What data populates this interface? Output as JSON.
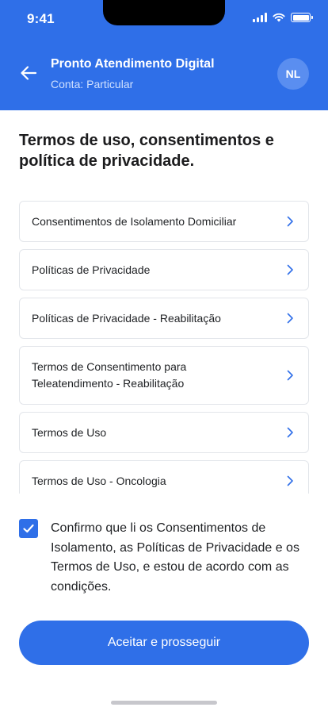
{
  "status_bar": {
    "time": "9:41"
  },
  "header": {
    "title": "Pronto Atendimento Digital",
    "subtitle": "Conta: Particular",
    "avatar_initials": "NL",
    "back_icon": "arrow-left-icon"
  },
  "page": {
    "title": "Termos de uso, consentimentos e política de privacidade."
  },
  "documents": [
    {
      "label": "Consentimentos de Isolamento Domiciliar"
    },
    {
      "label": "Políticas de Privacidade"
    },
    {
      "label": "Políticas de Privacidade - Reabilitação"
    },
    {
      "label": "Termos de Consentimento para Teleatendimento - Reabilitação"
    },
    {
      "label": "Termos de Uso"
    },
    {
      "label": "Termos de Uso - Oncologia"
    }
  ],
  "consent": {
    "checked": true,
    "text": "Confirmo que li os Consentimentos de Isolamento, as Políticas de Privacidade e os Termos de Uso, e estou de acordo com as condições."
  },
  "actions": {
    "accept_label": "Aceitar e prosseguir"
  },
  "colors": {
    "primary": "#2f6fe8",
    "chevron": "#2f6fe8",
    "border": "#e2e5ea"
  }
}
